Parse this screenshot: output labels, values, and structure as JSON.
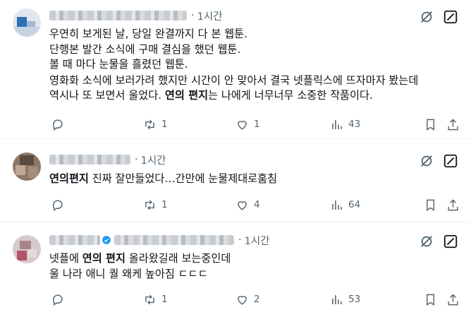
{
  "tweets": [
    {
      "time": "1시간",
      "lines": [
        "우연히 보게된 날, 당일 완결까지 다 본 웹툰.",
        "단행본 발간 소식에 구매 결심을 했던 웹툰.",
        "볼 때 마다 눈물을 흘렸던 웹툰.",
        "영화화 소식에 보러가려 했지만 시간이 안 맞아서 결국 넷플릭스에 뜨자마자 봤는데"
      ],
      "last_line": {
        "pre": "역시나 또 보면서 울었다. ",
        "bold": "연의 편지",
        "post": "는 나에게 너무너무 소중한 작품이다."
      },
      "replies": "",
      "retweets": "1",
      "likes": "1",
      "views": "43"
    },
    {
      "time": "1시간",
      "line": {
        "pre": "",
        "bold": "연의편지",
        "post": " 진짜 잘만들었다…간만에 눈물제대로훔침"
      },
      "replies": "",
      "retweets": "1",
      "likes": "4",
      "views": "64"
    },
    {
      "time": "1시간",
      "line1": {
        "pre": "넷플에 ",
        "bold": "연의 편지",
        "post": " 올라왔길래 보는중인데"
      },
      "line2": "울 나라 애니 퀄 왜케 높아짐 ㄷㄷㄷ",
      "replies": "",
      "retweets": "1",
      "likes": "2",
      "views": "53"
    }
  ],
  "icons": {
    "reply": "reply-icon",
    "retweet": "retweet-icon",
    "like": "heart-icon",
    "views": "views-icon",
    "bookmark": "bookmark-icon",
    "share": "share-icon",
    "more": "more-icon",
    "grok": "grok-icon"
  },
  "colors": {
    "text": "#0f1419",
    "secondary": "#536471",
    "verified": "#1d9bf0",
    "divider": "#eff3f4"
  }
}
